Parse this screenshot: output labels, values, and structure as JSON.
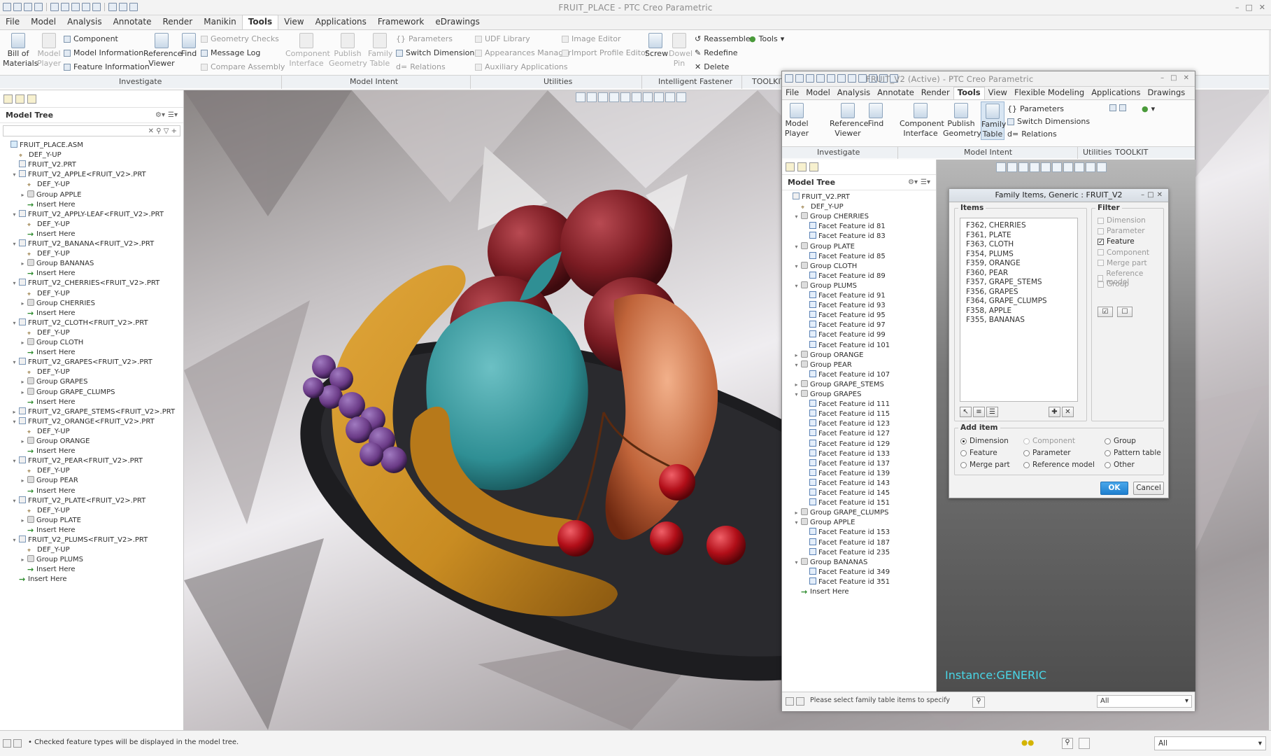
{
  "main_window": {
    "title": "FRUIT_PLACE - PTC Creo Parametric",
    "menu_tabs": [
      "File",
      "Model",
      "Analysis",
      "Annotate",
      "Render",
      "Manikin",
      "Tools",
      "View",
      "Applications",
      "Framework",
      "eDrawings"
    ],
    "active_tab": "Tools",
    "ribbon": {
      "bill_of_materials": {
        "line1": "Bill of",
        "line2": "Materials"
      },
      "model_player": {
        "line1": "Model",
        "line2": "Player"
      },
      "component": "Component",
      "model_information": "Model Information",
      "feature_information": "Feature Information",
      "reference_viewer": {
        "line1": "Reference",
        "line2": "Viewer"
      },
      "find": "Find",
      "geometry_checks": "Geometry Checks",
      "message_log": "Message Log",
      "compare_assembly": "Compare Assembly",
      "component_interface": {
        "line1": "Component",
        "line2": "Interface"
      },
      "publish_geometry": {
        "line1": "Publish",
        "line2": "Geometry"
      },
      "family_table": {
        "line1": "Family",
        "line2": "Table"
      },
      "parameters": "Parameters",
      "switch_dimensions": "Switch Dimensions",
      "relations": "Relations",
      "udf_library": "UDF Library",
      "appearances_manager": "Appearances Manager",
      "auxiliary_applications": "Auxiliary Applications",
      "image_editor": "Image Editor",
      "import_profile_editor": "Import Profile Editor",
      "screw": "Screw",
      "dowel_pin": {
        "line1": "Dowel",
        "line2": "Pin"
      },
      "reassemble": "Reassemble",
      "redefine": "Redefine",
      "delete": "Delete",
      "tools": "Tools"
    },
    "groups": [
      "Investigate",
      "Model Intent",
      "Utilities",
      "Intelligent Fastener",
      "TOOLKIT"
    ]
  },
  "model_tree": {
    "title": "Model Tree",
    "rows": [
      {
        "label": "FRUIT_PLACE.ASM",
        "indent": 0,
        "icon": "asm",
        "tw": ""
      },
      {
        "label": "DEF_Y-UP",
        "indent": 1,
        "icon": "datum",
        "tw": ""
      },
      {
        "label": "FRUIT_V2.PRT",
        "indent": 1,
        "icon": "prt",
        "tw": ""
      },
      {
        "label": "FRUIT_V2_APPLE<FRUIT_V2>.PRT",
        "indent": 1,
        "icon": "prt",
        "tw": "▾"
      },
      {
        "label": "DEF_Y-UP",
        "indent": 2,
        "icon": "datum",
        "tw": ""
      },
      {
        "label": "Group APPLE",
        "indent": 2,
        "icon": "grp",
        "tw": "▸"
      },
      {
        "label": "Insert Here",
        "indent": 2,
        "icon": "ins",
        "tw": ""
      },
      {
        "label": "FRUIT_V2_APPLY-LEAF<FRUIT_V2>.PRT",
        "indent": 1,
        "icon": "prt",
        "tw": "▾"
      },
      {
        "label": "DEF_Y-UP",
        "indent": 2,
        "icon": "datum",
        "tw": ""
      },
      {
        "label": "Insert Here",
        "indent": 2,
        "icon": "ins",
        "tw": ""
      },
      {
        "label": "FRUIT_V2_BANANA<FRUIT_V2>.PRT",
        "indent": 1,
        "icon": "prt",
        "tw": "▾"
      },
      {
        "label": "DEF_Y-UP",
        "indent": 2,
        "icon": "datum",
        "tw": ""
      },
      {
        "label": "Group BANANAS",
        "indent": 2,
        "icon": "grp",
        "tw": "▸"
      },
      {
        "label": "Insert Here",
        "indent": 2,
        "icon": "ins",
        "tw": ""
      },
      {
        "label": "FRUIT_V2_CHERRIES<FRUIT_V2>.PRT",
        "indent": 1,
        "icon": "prt",
        "tw": "▾"
      },
      {
        "label": "DEF_Y-UP",
        "indent": 2,
        "icon": "datum",
        "tw": ""
      },
      {
        "label": "Group CHERRIES",
        "indent": 2,
        "icon": "grp",
        "tw": "▸"
      },
      {
        "label": "Insert Here",
        "indent": 2,
        "icon": "ins",
        "tw": ""
      },
      {
        "label": "FRUIT_V2_CLOTH<FRUIT_V2>.PRT",
        "indent": 1,
        "icon": "prt",
        "tw": "▾"
      },
      {
        "label": "DEF_Y-UP",
        "indent": 2,
        "icon": "datum",
        "tw": ""
      },
      {
        "label": "Group CLOTH",
        "indent": 2,
        "icon": "grp",
        "tw": "▸"
      },
      {
        "label": "Insert Here",
        "indent": 2,
        "icon": "ins",
        "tw": ""
      },
      {
        "label": "FRUIT_V2_GRAPES<FRUIT_V2>.PRT",
        "indent": 1,
        "icon": "prt",
        "tw": "▾"
      },
      {
        "label": "DEF_Y-UP",
        "indent": 2,
        "icon": "datum",
        "tw": ""
      },
      {
        "label": "Group GRAPES",
        "indent": 2,
        "icon": "grp",
        "tw": "▸"
      },
      {
        "label": "Group GRAPE_CLUMPS",
        "indent": 2,
        "icon": "grp",
        "tw": "▸"
      },
      {
        "label": "Insert Here",
        "indent": 2,
        "icon": "ins",
        "tw": ""
      },
      {
        "label": "FRUIT_V2_GRAPE_STEMS<FRUIT_V2>.PRT",
        "indent": 1,
        "icon": "prt",
        "tw": "▸"
      },
      {
        "label": "FRUIT_V2_ORANGE<FRUIT_V2>.PRT",
        "indent": 1,
        "icon": "prt",
        "tw": "▾"
      },
      {
        "label": "DEF_Y-UP",
        "indent": 2,
        "icon": "datum",
        "tw": ""
      },
      {
        "label": "Group ORANGE",
        "indent": 2,
        "icon": "grp",
        "tw": "▸"
      },
      {
        "label": "Insert Here",
        "indent": 2,
        "icon": "ins",
        "tw": ""
      },
      {
        "label": "FRUIT_V2_PEAR<FRUIT_V2>.PRT",
        "indent": 1,
        "icon": "prt",
        "tw": "▾"
      },
      {
        "label": "DEF_Y-UP",
        "indent": 2,
        "icon": "datum",
        "tw": ""
      },
      {
        "label": "Group PEAR",
        "indent": 2,
        "icon": "grp",
        "tw": "▸"
      },
      {
        "label": "Insert Here",
        "indent": 2,
        "icon": "ins",
        "tw": ""
      },
      {
        "label": "FRUIT_V2_PLATE<FRUIT_V2>.PRT",
        "indent": 1,
        "icon": "prt",
        "tw": "▾"
      },
      {
        "label": "DEF_Y-UP",
        "indent": 2,
        "icon": "datum",
        "tw": ""
      },
      {
        "label": "Group PLATE",
        "indent": 2,
        "icon": "grp",
        "tw": "▸"
      },
      {
        "label": "Insert Here",
        "indent": 2,
        "icon": "ins",
        "tw": ""
      },
      {
        "label": "FRUIT_V2_PLUMS<FRUIT_V2>.PRT",
        "indent": 1,
        "icon": "prt",
        "tw": "▾"
      },
      {
        "label": "DEF_Y-UP",
        "indent": 2,
        "icon": "datum",
        "tw": ""
      },
      {
        "label": "Group PLUMS",
        "indent": 2,
        "icon": "grp",
        "tw": "▸"
      },
      {
        "label": "Insert Here",
        "indent": 2,
        "icon": "ins",
        "tw": ""
      },
      {
        "label": "Insert Here",
        "indent": 1,
        "icon": "ins",
        "tw": ""
      }
    ]
  },
  "status": {
    "message": "• Checked feature types will be displayed in the model tree.",
    "filter": "All"
  },
  "child_window": {
    "title": "FRUIT_V2 (Active) - PTC Creo Parametric",
    "menu_tabs": [
      "File",
      "Model",
      "Analysis",
      "Annotate",
      "Render",
      "Tools",
      "View",
      "Flexible Modeling",
      "Applications",
      "Drawings"
    ],
    "active_tab": "Tools",
    "ribbon": {
      "model_player": {
        "line1": "Model",
        "line2": "Player"
      },
      "reference_viewer": {
        "line1": "Reference",
        "line2": "Viewer"
      },
      "find": "Find",
      "component_interface": {
        "line1": "Component",
        "line2": "Interface"
      },
      "publish_geometry": {
        "line1": "Publish",
        "line2": "Geometry"
      },
      "family_table": {
        "line1": "Family",
        "line2": "Table"
      },
      "parameters": "Parameters",
      "switch_dimensions": "Switch Dimensions",
      "relations": "Relations"
    },
    "groups": [
      "Investigate",
      "Model Intent",
      "Utilities",
      "TOOLKIT"
    ],
    "model_tree": {
      "title": "Model Tree",
      "rows": [
        {
          "label": "FRUIT_V2.PRT",
          "indent": 0,
          "icon": "prt",
          "tw": ""
        },
        {
          "label": "DEF_Y-UP",
          "indent": 1,
          "icon": "datum",
          "tw": ""
        },
        {
          "label": "Group CHERRIES",
          "indent": 1,
          "icon": "grp",
          "tw": "▾"
        },
        {
          "label": "Facet Feature id 81",
          "indent": 2,
          "icon": "facet",
          "tw": ""
        },
        {
          "label": "Facet Feature id 83",
          "indent": 2,
          "icon": "facet",
          "tw": ""
        },
        {
          "label": "Group PLATE",
          "indent": 1,
          "icon": "grp",
          "tw": "▾"
        },
        {
          "label": "Facet Feature id 85",
          "indent": 2,
          "icon": "facet",
          "tw": ""
        },
        {
          "label": "Group CLOTH",
          "indent": 1,
          "icon": "grp",
          "tw": "▾"
        },
        {
          "label": "Facet Feature id 89",
          "indent": 2,
          "icon": "facet",
          "tw": ""
        },
        {
          "label": "Group PLUMS",
          "indent": 1,
          "icon": "grp",
          "tw": "▾"
        },
        {
          "label": "Facet Feature id 91",
          "indent": 2,
          "icon": "facet",
          "tw": ""
        },
        {
          "label": "Facet Feature id 93",
          "indent": 2,
          "icon": "facet",
          "tw": ""
        },
        {
          "label": "Facet Feature id 95",
          "indent": 2,
          "icon": "facet",
          "tw": ""
        },
        {
          "label": "Facet Feature id 97",
          "indent": 2,
          "icon": "facet",
          "tw": ""
        },
        {
          "label": "Facet Feature id 99",
          "indent": 2,
          "icon": "facet",
          "tw": ""
        },
        {
          "label": "Facet Feature id 101",
          "indent": 2,
          "icon": "facet",
          "tw": ""
        },
        {
          "label": "Group ORANGE",
          "indent": 1,
          "icon": "grp",
          "tw": "▸"
        },
        {
          "label": "Group PEAR",
          "indent": 1,
          "icon": "grp",
          "tw": "▾"
        },
        {
          "label": "Facet Feature id 107",
          "indent": 2,
          "icon": "facet",
          "tw": ""
        },
        {
          "label": "Group GRAPE_STEMS",
          "indent": 1,
          "icon": "grp",
          "tw": "▸"
        },
        {
          "label": "Group GRAPES",
          "indent": 1,
          "icon": "grp",
          "tw": "▾"
        },
        {
          "label": "Facet Feature id 111",
          "indent": 2,
          "icon": "facet",
          "tw": ""
        },
        {
          "label": "Facet Feature id 115",
          "indent": 2,
          "icon": "facet",
          "tw": ""
        },
        {
          "label": "Facet Feature id 123",
          "indent": 2,
          "icon": "facet",
          "tw": ""
        },
        {
          "label": "Facet Feature id 127",
          "indent": 2,
          "icon": "facet",
          "tw": ""
        },
        {
          "label": "Facet Feature id 129",
          "indent": 2,
          "icon": "facet",
          "tw": ""
        },
        {
          "label": "Facet Feature id 133",
          "indent": 2,
          "icon": "facet",
          "tw": ""
        },
        {
          "label": "Facet Feature id 137",
          "indent": 2,
          "icon": "facet",
          "tw": ""
        },
        {
          "label": "Facet Feature id 139",
          "indent": 2,
          "icon": "facet",
          "tw": ""
        },
        {
          "label": "Facet Feature id 143",
          "indent": 2,
          "icon": "facet",
          "tw": ""
        },
        {
          "label": "Facet Feature id 145",
          "indent": 2,
          "icon": "facet",
          "tw": ""
        },
        {
          "label": "Facet Feature id 151",
          "indent": 2,
          "icon": "facet",
          "tw": ""
        },
        {
          "label": "Group GRAPE_CLUMPS",
          "indent": 1,
          "icon": "grp",
          "tw": "▸"
        },
        {
          "label": "Group APPLE",
          "indent": 1,
          "icon": "grp",
          "tw": "▾"
        },
        {
          "label": "Facet Feature id 153",
          "indent": 2,
          "icon": "facet",
          "tw": ""
        },
        {
          "label": "Facet Feature id 187",
          "indent": 2,
          "icon": "facet",
          "tw": ""
        },
        {
          "label": "Facet Feature id 235",
          "indent": 2,
          "icon": "facet",
          "tw": ""
        },
        {
          "label": "Group BANANAS",
          "indent": 1,
          "icon": "grp",
          "tw": "▾"
        },
        {
          "label": "Facet Feature id 349",
          "indent": 2,
          "icon": "facet",
          "tw": ""
        },
        {
          "label": "Facet Feature id 351",
          "indent": 2,
          "icon": "facet",
          "tw": ""
        },
        {
          "label": "Insert Here",
          "indent": 1,
          "icon": "ins",
          "tw": ""
        }
      ]
    },
    "instance_label": "Instance:GENERIC",
    "status_message": "Please select family table items to specify val",
    "status_filter": "All"
  },
  "dialog": {
    "title": "Family Items,  Generic : FRUIT_V2",
    "items_label": "Items",
    "items": [
      "F362, CHERRIES",
      "F361, PLATE",
      "F363, CLOTH",
      "F354, PLUMS",
      "F359, ORANGE",
      "F360, PEAR",
      "F357, GRAPE_STEMS",
      "F356, GRAPES",
      "F364, GRAPE_CLUMPS",
      "F358, APPLE",
      "F355, BANANAS"
    ],
    "filter_label": "Filter",
    "filters": [
      {
        "label": "Dimension",
        "checked": false
      },
      {
        "label": "Parameter",
        "checked": false
      },
      {
        "label": "Feature",
        "checked": true
      },
      {
        "label": "Component",
        "checked": false
      },
      {
        "label": "Merge part",
        "checked": false
      },
      {
        "label": "Reference model",
        "checked": false
      },
      {
        "label": "Group",
        "checked": false
      }
    ],
    "add_item_label": "Add item",
    "add_options": {
      "dimension": "Dimension",
      "feature": "Feature",
      "merge_part": "Merge part",
      "component": "Component",
      "parameter": "Parameter",
      "reference_model": "Reference model",
      "group": "Group",
      "pattern_table": "Pattern table",
      "other": "Other"
    },
    "selected_option": "Dimension",
    "ok": "OK",
    "cancel": "Cancel"
  },
  "colors": {
    "accent": "#1f7fcf",
    "instance_text": "#49d6e6",
    "plate": "#1d1d20",
    "banana": "#c98c22",
    "apple": "#2f8f94",
    "plum": "#7a1b22",
    "grape": "#6a3a86",
    "pear": "#c0643a",
    "cherry": "#b10e18"
  }
}
